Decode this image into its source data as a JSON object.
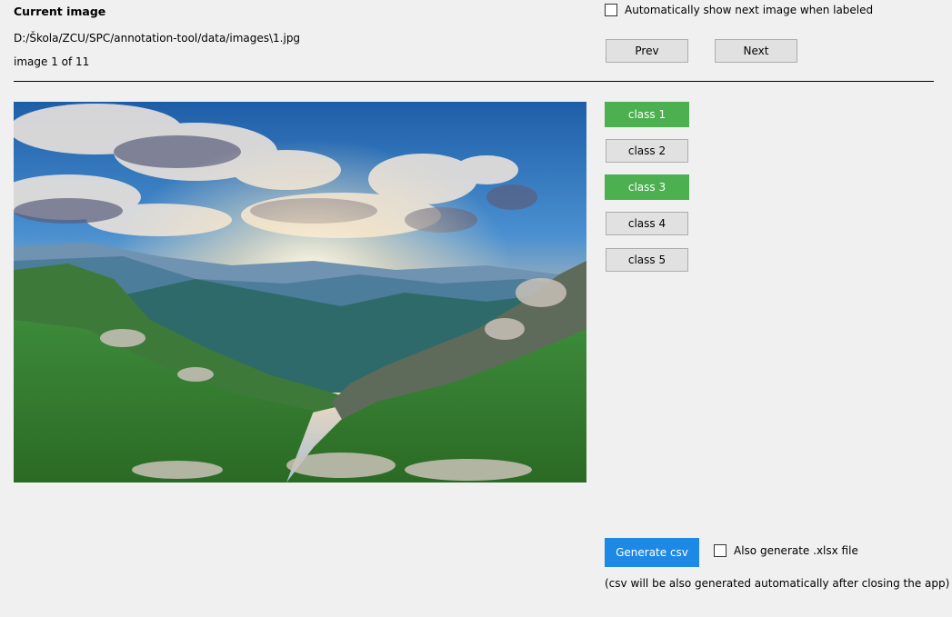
{
  "header": {
    "title": "Current image",
    "file_path": "D:/Škola/ZCU/SPC/annotation-tool/data/images\\1.jpg",
    "counter": "image 1 of 11"
  },
  "navigation": {
    "auto_next_label": "Automatically show next image when labeled",
    "auto_next_checked": false,
    "prev_label": "Prev",
    "next_label": "Next"
  },
  "image": {
    "description": "Mountain landscape with sun rays through clouds over green valley"
  },
  "classes": [
    {
      "label": "class 1",
      "selected": true
    },
    {
      "label": "class 2",
      "selected": false
    },
    {
      "label": "class 3",
      "selected": true
    },
    {
      "label": "class 4",
      "selected": false
    },
    {
      "label": "class 5",
      "selected": false
    }
  ],
  "export": {
    "generate_label": "Generate csv",
    "xlsx_label": "Also generate .xlsx file",
    "xlsx_checked": false,
    "note": "(csv will be also generated automatically after closing the app)"
  },
  "colors": {
    "selected": "#4caf50",
    "primary": "#1e88e5",
    "button_bg": "#e1e1e1",
    "window_bg": "#f0f0f0"
  }
}
